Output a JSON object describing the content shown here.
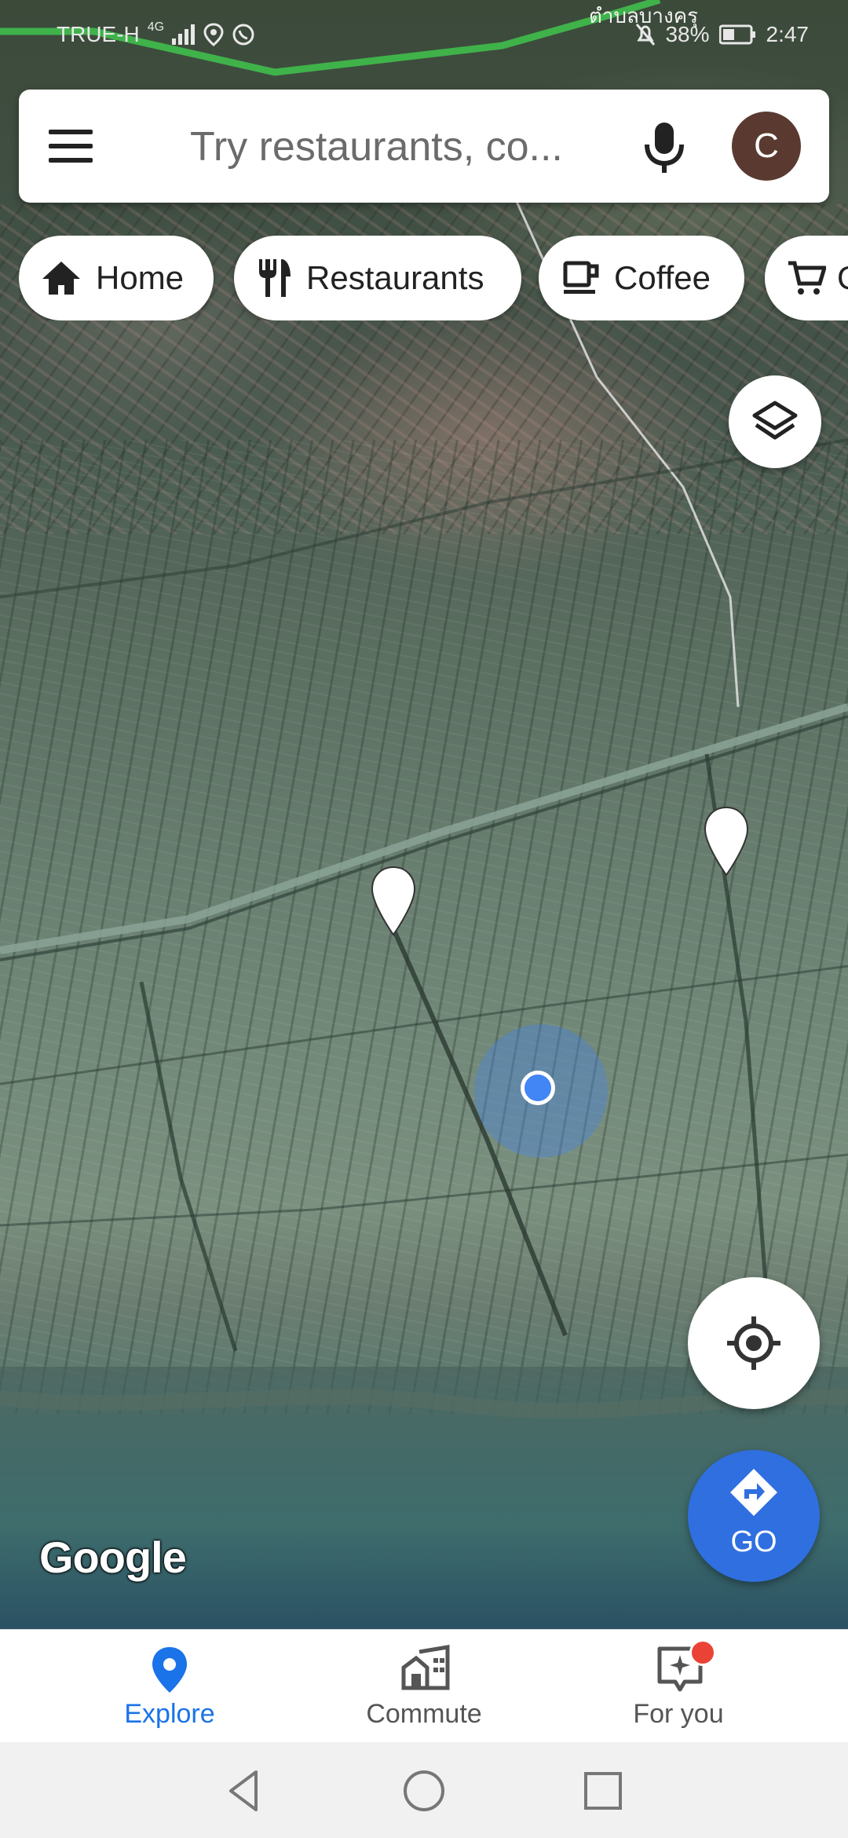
{
  "status_bar": {
    "carrier": "TRUE-H",
    "network": "4G",
    "place_label": "ตำบลบางครุ",
    "battery": "38%",
    "time": "2:47"
  },
  "search": {
    "placeholder": "Try restaurants, co...",
    "avatar_initial": "C"
  },
  "chips": [
    {
      "label": "Home",
      "icon": "home-icon"
    },
    {
      "label": "Restaurants",
      "icon": "fork-knife-icon"
    },
    {
      "label": "Coffee",
      "icon": "coffee-cup-icon"
    },
    {
      "label": "G",
      "icon": "shopping-cart-icon"
    }
  ],
  "map": {
    "watermark": "Google",
    "go_label": "GO",
    "location_accent": "#4285f4",
    "go_color": "#2f6fe0"
  },
  "bottom_nav": {
    "items": [
      {
        "label": "Explore",
        "icon": "explore-pin-icon",
        "active": true
      },
      {
        "label": "Commute",
        "icon": "commute-icon",
        "active": false
      },
      {
        "label": "For you",
        "icon": "for-you-icon",
        "active": false,
        "badge": true
      }
    ],
    "active_color": "#1a73e8"
  },
  "system_nav": [
    "back",
    "home",
    "recents"
  ]
}
